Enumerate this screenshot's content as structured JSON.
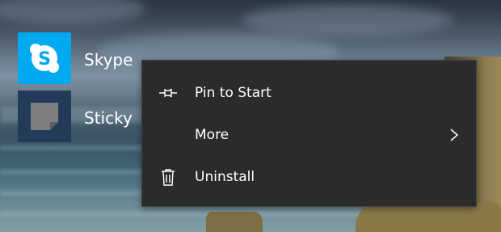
{
  "tiles": [
    {
      "label": "Skype",
      "icon": "skype-icon",
      "color": "#00a9f0"
    },
    {
      "label": "Sticky",
      "icon": "sticky-notes-icon",
      "color": "#213b59"
    }
  ],
  "context_menu": {
    "background": "#2b2b2b",
    "items": [
      {
        "label": "Pin to Start",
        "icon": "pin-icon"
      },
      {
        "label": "More",
        "icon": "chevron-right-icon"
      },
      {
        "label": "Uninstall",
        "icon": "trash-icon"
      }
    ]
  }
}
